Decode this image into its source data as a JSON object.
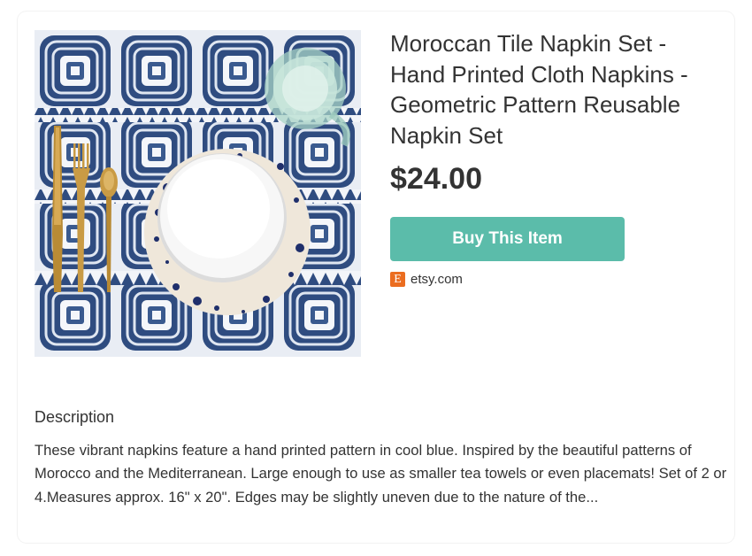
{
  "product": {
    "image_alt": "Moroccan Tile Napkin Set on table setting",
    "title": "Moroccan Tile Napkin Set - Hand Printed Cloth Napkins - Geometric Pattern Reusable Napkin Set",
    "price": "$24.00",
    "buy_label": "Buy This Item",
    "source_logo_letter": "E",
    "source_domain": "etsy.com"
  },
  "description": {
    "heading": "Description",
    "text": "These vibrant napkins feature a hand printed pattern in cool blue. Inspired by the beautiful patterns of Morocco and the Mediterranean. Large enough to use as smaller tea towels or even placemats! Set of 2 or 4.Measures approx. 16\" x 20\". Edges may be slightly uneven due to the nature of the..."
  },
  "colors": {
    "button": "#5bbcaa",
    "etsy_logo": "#eb6d20",
    "pattern_ink": "#2b4a7e",
    "text": "#333333"
  }
}
